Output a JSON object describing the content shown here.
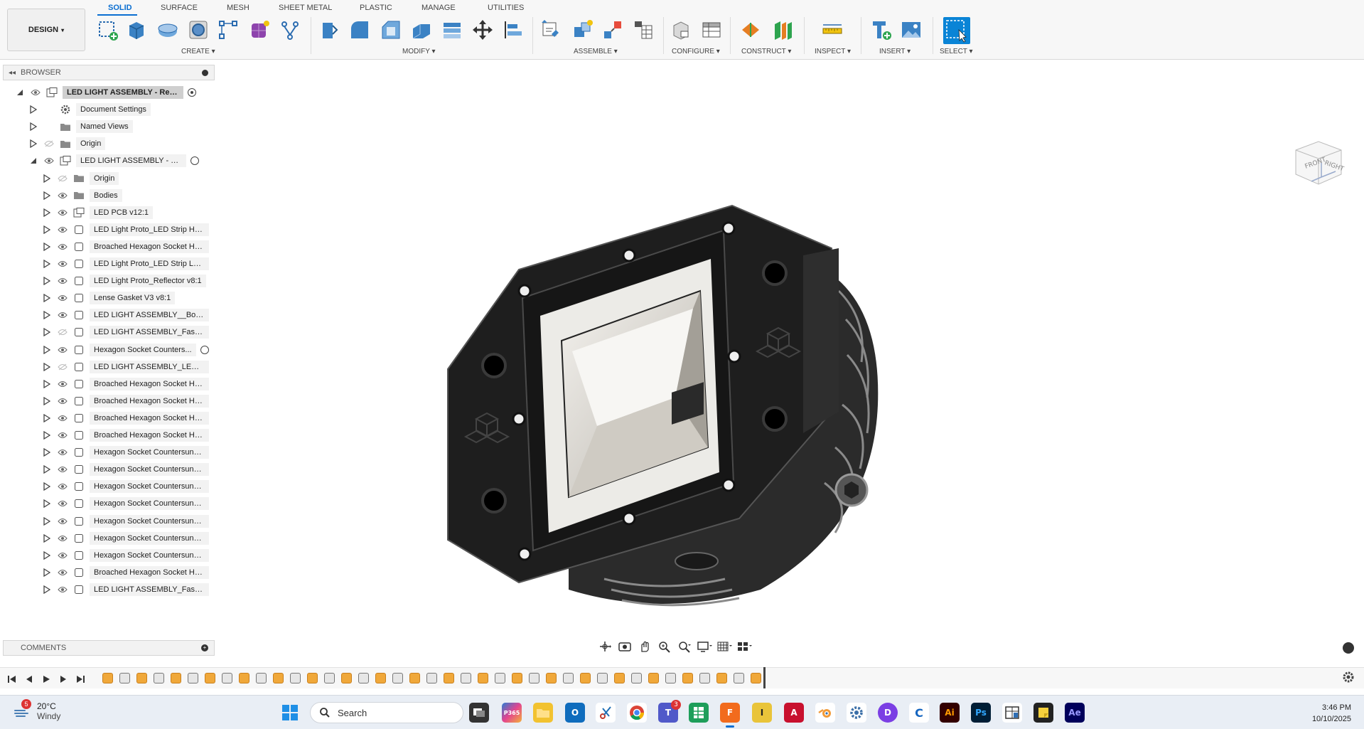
{
  "toolbar": {
    "design_label": "DESIGN",
    "tabs": [
      {
        "label": "SOLID",
        "active": true
      },
      {
        "label": "SURFACE"
      },
      {
        "label": "MESH"
      },
      {
        "label": "SHEET METAL"
      },
      {
        "label": "PLASTIC"
      },
      {
        "label": "MANAGE"
      },
      {
        "label": "UTILITIES"
      }
    ],
    "groups": [
      {
        "label": "CREATE ▾"
      },
      {
        "label": "MODIFY ▾"
      },
      {
        "label": "ASSEMBLE ▾"
      },
      {
        "label": "CONFIGURE ▾"
      },
      {
        "label": "CONSTRUCT ▾"
      },
      {
        "label": "INSPECT ▾"
      },
      {
        "label": "INSERT ▾"
      },
      {
        "label": "SELECT ▾"
      }
    ]
  },
  "browser": {
    "title": "BROWSER",
    "items": [
      {
        "label": "LED LIGHT ASSEMBLY - Rend...",
        "selected": true
      },
      {
        "label": "Document Settings"
      },
      {
        "label": "Named Views"
      },
      {
        "label": "Origin"
      },
      {
        "label": "LED LIGHT ASSEMBLY - Renc..."
      },
      {
        "label": "Origin"
      },
      {
        "label": "Bodies"
      },
      {
        "label": "LED PCB v12:1"
      },
      {
        "label": "LED Light Proto_LED Strip Hous..."
      },
      {
        "label": "Broached Hexagon Socket Hea..."
      },
      {
        "label": "LED Light Proto_LED Strip Lens..."
      },
      {
        "label": "LED Light Proto_Reflector v8:1"
      },
      {
        "label": "Lense Gasket V3 v8:1"
      },
      {
        "label": "LED LIGHT ASSEMBLY__Body ..."
      },
      {
        "label": "LED LIGHT ASSEMBLY_Fascia ..."
      },
      {
        "label": "Hexagon Socket Counters..."
      },
      {
        "label": "LED LIGHT ASSEMBLY_LED BF..."
      },
      {
        "label": "Broached Hexagon Socket Hea..."
      },
      {
        "label": "Broached Hexagon Socket Hea..."
      },
      {
        "label": "Broached Hexagon Socket Hea..."
      },
      {
        "label": "Broached Hexagon Socket Hea..."
      },
      {
        "label": "Hexagon Socket Countersunk H..."
      },
      {
        "label": "Hexagon Socket Countersunk H..."
      },
      {
        "label": "Hexagon Socket Countersunk H..."
      },
      {
        "label": "Hexagon Socket Countersunk H..."
      },
      {
        "label": "Hexagon Socket Countersunk H..."
      },
      {
        "label": "Hexagon Socket Countersunk H..."
      },
      {
        "label": "Hexagon Socket Countersunk H..."
      },
      {
        "label": "Broached Hexagon Socket Hea..."
      },
      {
        "label": "LED LIGHT ASSEMBLY_Fascia ..."
      }
    ]
  },
  "comments": {
    "title": "COMMENTS"
  },
  "viewcube": {
    "front": "FRONT",
    "right": "RIGHT"
  },
  "taskbar": {
    "weather_temp": "20°C",
    "weather_cond": "Windy",
    "weather_badge": "5",
    "search_placeholder": "Search",
    "teams_badge": "3",
    "time": "3:46 PM",
    "date": "10/10/2025",
    "apps": [
      "P365",
      "I",
      "A",
      "Ai",
      "Ps",
      "Ae"
    ]
  },
  "colors": {
    "accent": "#0a6ed1",
    "timeline_feature": "#f0a83a"
  }
}
